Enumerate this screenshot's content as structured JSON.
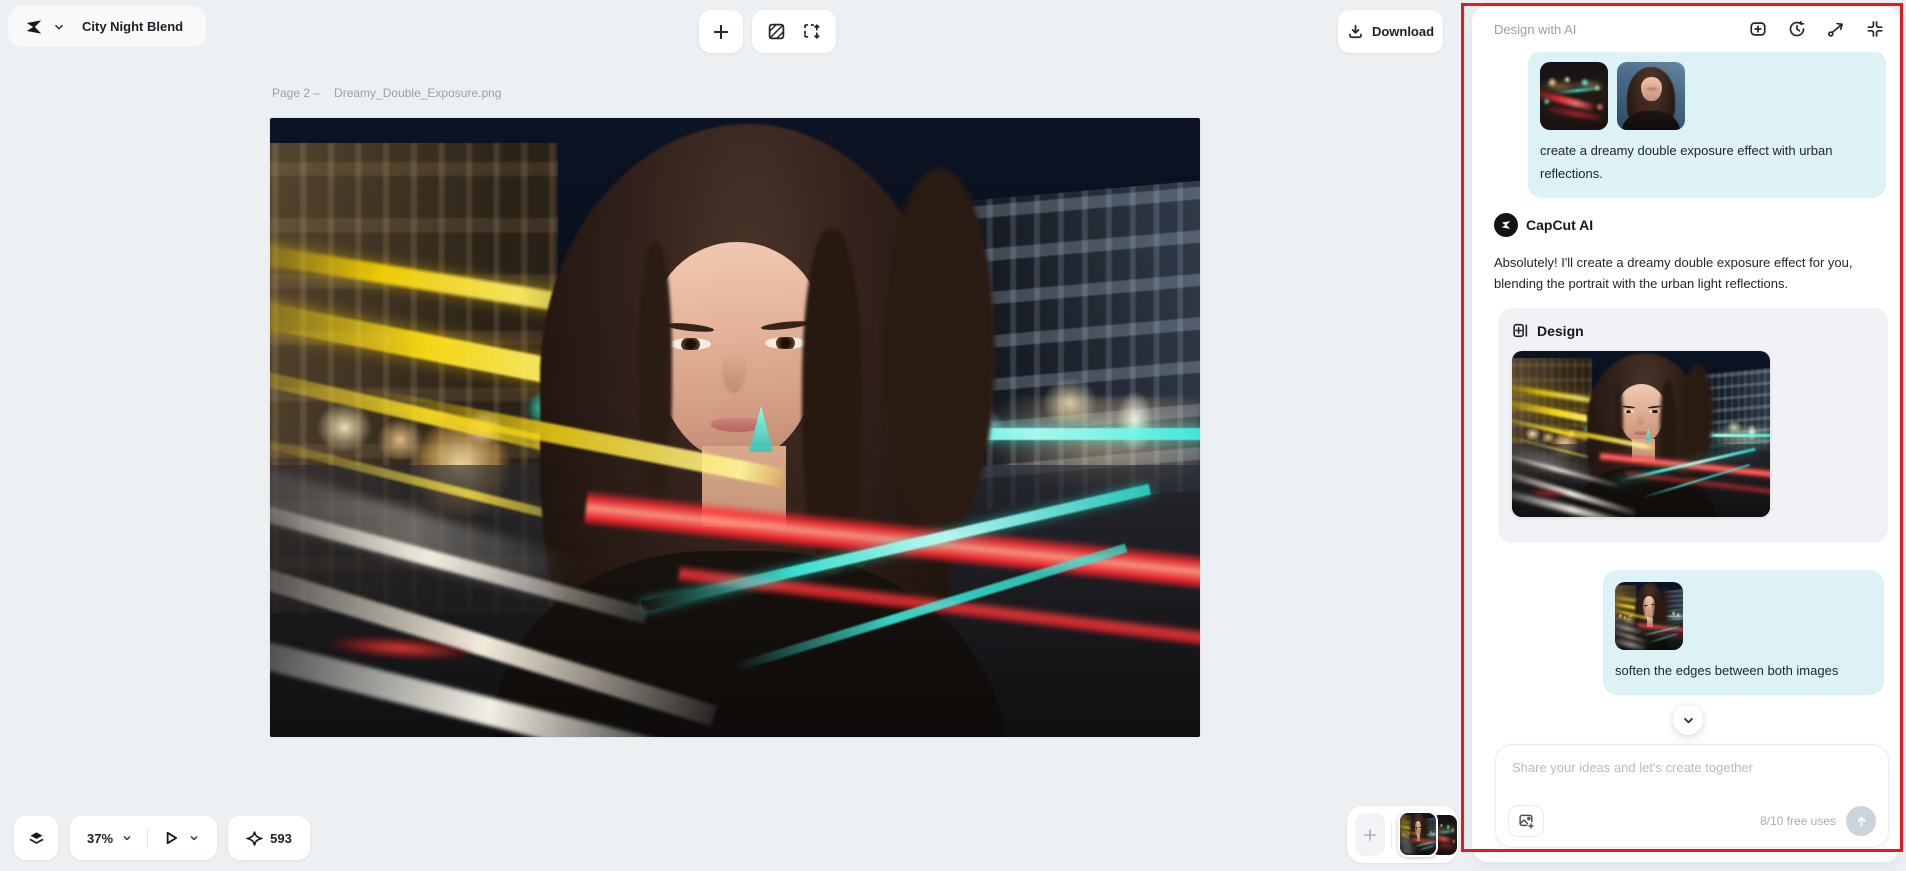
{
  "window": {
    "title": "City Night Blend"
  },
  "toolbar": {
    "download_label": "Download"
  },
  "canvas": {
    "page_label": "Page 2 –",
    "filename": "Dreamy_Double_Exposure.png"
  },
  "statusbar": {
    "zoom_level": "37%",
    "credits": "593"
  },
  "ai_panel": {
    "title": "Design with AI",
    "assistant_name": "CapCut AI",
    "user_message_1": "create a dreamy double exposure effect with urban reflections.",
    "assistant_message_1": "Absolutely! I'll create a dreamy double exposure effect for you, blending the portrait with the urban light reflections.",
    "design_card_title": "Design",
    "user_message_2": "soften the edges between both images",
    "input_placeholder": "Share your ideas and let's create together",
    "usage_label": "8/10 free uses"
  },
  "icons": {
    "header_icons": [
      "new-chat-icon",
      "history-icon",
      "share-icon",
      "collapse-icon"
    ],
    "attachment_1": "city-night-photo",
    "attachment_2": "portrait-photo",
    "design_result": "double-exposure-design"
  },
  "colors": {
    "page_bg": "#edf0f3",
    "user_bubble": "#ddf2f5",
    "annotation_red": "#e8191d",
    "send_button_disabled": "#ccd3dc"
  }
}
